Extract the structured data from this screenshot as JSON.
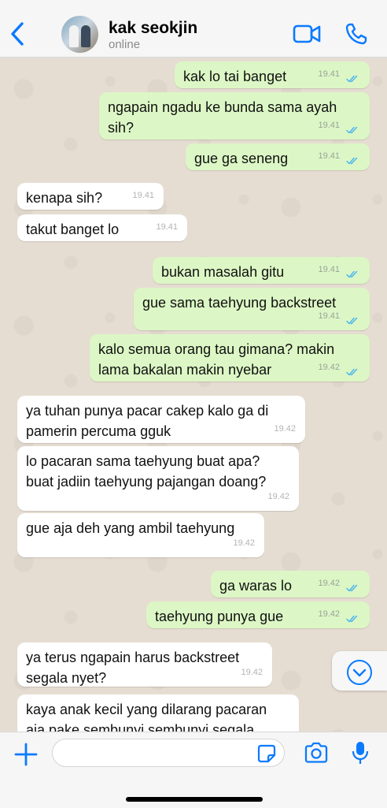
{
  "header": {
    "contact_name": "kak seokjin",
    "status": "online"
  },
  "messages": [
    {
      "dir": "out",
      "lines": [
        "kak lo tai banget"
      ],
      "time": "19.41",
      "read": true
    },
    {
      "dir": "out",
      "lines": [
        "ngapain ngadu ke bunda sama ayah",
        "sih?"
      ],
      "time": "19.41",
      "read": true
    },
    {
      "dir": "out",
      "lines": [
        "gue ga seneng"
      ],
      "time": "19.41",
      "read": true
    },
    {
      "dir": "in",
      "lines": [
        "kenapa sih?"
      ],
      "time": "19.41"
    },
    {
      "dir": "in",
      "lines": [
        "takut banget lo"
      ],
      "time": "19.41"
    },
    {
      "dir": "out",
      "lines": [
        "bukan masalah gitu"
      ],
      "time": "19.41",
      "read": true
    },
    {
      "dir": "out",
      "lines": [
        "gue sama taehyung backstreet"
      ],
      "time": "19.41",
      "read": true
    },
    {
      "dir": "out",
      "lines": [
        "kalo semua orang tau gimana? makin",
        "lama bakalan makin nyebar"
      ],
      "time": "19.42",
      "read": true
    },
    {
      "dir": "in",
      "lines": [
        "ya tuhan punya pacar cakep kalo ga di",
        "pamerin percuma gguk"
      ],
      "time": "19.42"
    },
    {
      "dir": "in",
      "lines": [
        "lo pacaran sama taehyung buat apa?",
        "buat jadiin taehyung pajangan doang?"
      ],
      "time": "19.42"
    },
    {
      "dir": "in",
      "lines": [
        "gue aja deh yang ambil taehyung"
      ],
      "time": "19.42"
    },
    {
      "dir": "out",
      "lines": [
        "ga waras lo"
      ],
      "time": "19.42",
      "read": true
    },
    {
      "dir": "out",
      "lines": [
        "taehyung punya gue"
      ],
      "time": "19.42",
      "read": true
    },
    {
      "dir": "in",
      "lines": [
        "ya terus ngapain harus backstreet",
        "segala nyet?"
      ],
      "time": "19.42"
    },
    {
      "dir": "in",
      "lines": [
        "kaya anak kecil yang dilarang pacaran",
        "aja pake sembunyi sembunyi segala"
      ],
      "time": ""
    }
  ],
  "composer": {
    "placeholder": ""
  },
  "colors": {
    "accent": "#0a7aff",
    "outgoing_bubble": "#dcf7c5",
    "incoming_bubble": "#ffffff",
    "read_ticks": "#4fb6ec",
    "chat_background": "#e6ddd2"
  },
  "icons": [
    "back-chevron-icon",
    "video-call-icon",
    "phone-icon",
    "chevron-down-icon",
    "plus-icon",
    "sticker-icon",
    "camera-icon",
    "microphone-icon"
  ]
}
